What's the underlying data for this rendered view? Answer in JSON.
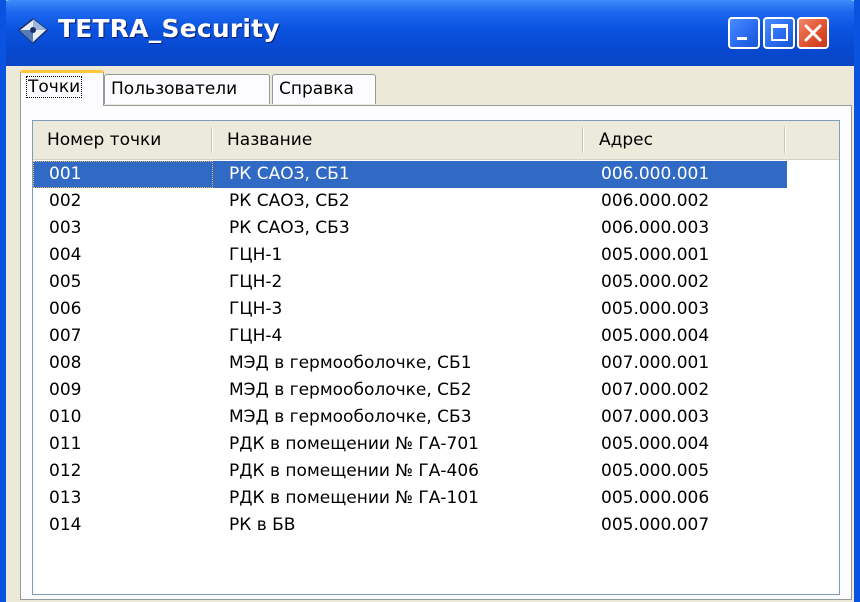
{
  "window": {
    "title": "TETRA_Security",
    "icon": "app-icon",
    "buttons": {
      "minimize": "minimize-icon",
      "maximize": "maximize-icon",
      "close": "close-icon"
    }
  },
  "tabs": [
    {
      "label": "Точки",
      "active": true
    },
    {
      "label": "Пользователи",
      "active": false
    },
    {
      "label": "Справка",
      "active": false
    }
  ],
  "table": {
    "columns": [
      "Номер точки",
      "Название",
      "Адрес"
    ],
    "selected_row": 0,
    "rows": [
      [
        "001",
        "РК САОЗ, СБ1",
        "006.000.001"
      ],
      [
        "002",
        "РК САОЗ, СБ2",
        "006.000.002"
      ],
      [
        "003",
        "РК САОЗ, СБ3",
        "006.000.003"
      ],
      [
        "004",
        "ГЦН-1",
        "005.000.001"
      ],
      [
        "005",
        "ГЦН-2",
        "005.000.002"
      ],
      [
        "006",
        "ГЦН-3",
        "005.000.003"
      ],
      [
        "007",
        "ГЦН-4",
        "005.000.004"
      ],
      [
        "008",
        "МЭД в гермооболочке, СБ1",
        "007.000.001"
      ],
      [
        "009",
        "МЭД в гермооболочке, СБ2",
        "007.000.002"
      ],
      [
        "010",
        "МЭД в гермооболочке, СБ3",
        "007.000.003"
      ],
      [
        "011",
        "РДК в помещении № ГА-701",
        "005.000.004"
      ],
      [
        "012",
        "РДК в помещении № ГА-406",
        "005.000.005"
      ],
      [
        "013",
        "РДК в помещении № ГА-101",
        "005.000.006"
      ],
      [
        "014",
        "РК в БВ",
        "005.000.007"
      ]
    ]
  },
  "colors": {
    "titlebar": "#0a53df",
    "selection": "#316ac5",
    "tab_highlight": "#ffc83c",
    "close_button": "#e0532e"
  }
}
